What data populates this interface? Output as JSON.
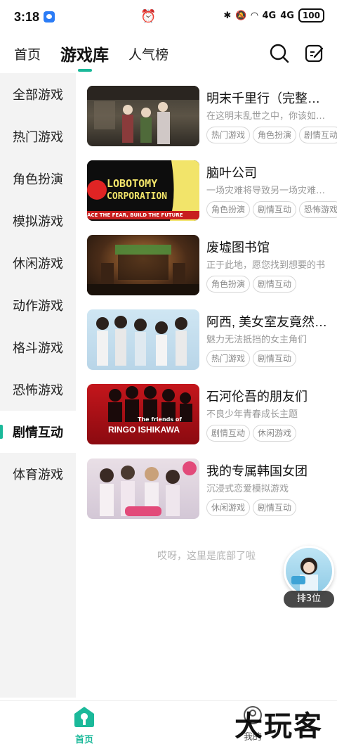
{
  "status_bar": {
    "time": "3:18",
    "signal_1": "4G",
    "signal_2": "4G",
    "battery": "100"
  },
  "top_nav": {
    "tabs": [
      {
        "label": "首页"
      },
      {
        "label": "游戏库"
      },
      {
        "label": "人气榜"
      }
    ],
    "active_tab": "游戏库"
  },
  "sidebar": {
    "items": [
      {
        "label": "全部游戏"
      },
      {
        "label": "热门游戏"
      },
      {
        "label": "角色扮演"
      },
      {
        "label": "模拟游戏"
      },
      {
        "label": "休闲游戏"
      },
      {
        "label": "动作游戏"
      },
      {
        "label": "格斗游戏"
      },
      {
        "label": "恐怖游戏"
      },
      {
        "label": "剧情互动"
      },
      {
        "label": "体育游戏"
      }
    ],
    "active_item": "剧情互动"
  },
  "games": [
    {
      "title": "明末千里行（完整版）",
      "desc": "在这明末乱世之中，你该如何生存",
      "tags": [
        "热门游戏",
        "角色扮演",
        "剧情互动"
      ]
    },
    {
      "title": "脑叶公司",
      "desc": "一场灾难将导致另一场灾难的发生",
      "tags": [
        "角色扮演",
        "剧情互动",
        "恐怖游戏"
      ],
      "thumb_text_1": "LOBOTOMY",
      "thumb_text_2": "CORPORATION",
      "thumb_text_3": "ACE THE FEAR, BUILD THE FUTURE"
    },
    {
      "title": "废墟图书馆",
      "desc": "正于此地，愿您找到想要的书",
      "tags": [
        "角色扮演",
        "剧情互动"
      ]
    },
    {
      "title": "阿西, 美女室友竟然是偶像",
      "desc": "魅力无法抵挡的女主角们",
      "tags": [
        "热门游戏",
        "剧情互动"
      ]
    },
    {
      "title": "石河伦吾的朋友们",
      "desc": "不良少年青春成长主题",
      "tags": [
        "剧情互动",
        "休闲游戏"
      ],
      "thumb_text_1": "The friends of",
      "thumb_text_2": "RINGO ISHIKAWA"
    },
    {
      "title": "我的专属韩国女团",
      "desc": "沉浸式恋爱模拟游戏",
      "tags": [
        "休闲游戏",
        "剧情互动"
      ]
    }
  ],
  "end_text": "哎呀，这里是底部了啦",
  "rank_badge": {
    "label": "排3位"
  },
  "bottom_nav": {
    "home_label": "首页",
    "me_label": "我的"
  },
  "watermark": "大玩客",
  "colors": {
    "accent": "#1bb99a",
    "sidebar_bg": "#f3f3f3",
    "tag_border": "#d6d6d6",
    "desc_text": "#999999"
  }
}
